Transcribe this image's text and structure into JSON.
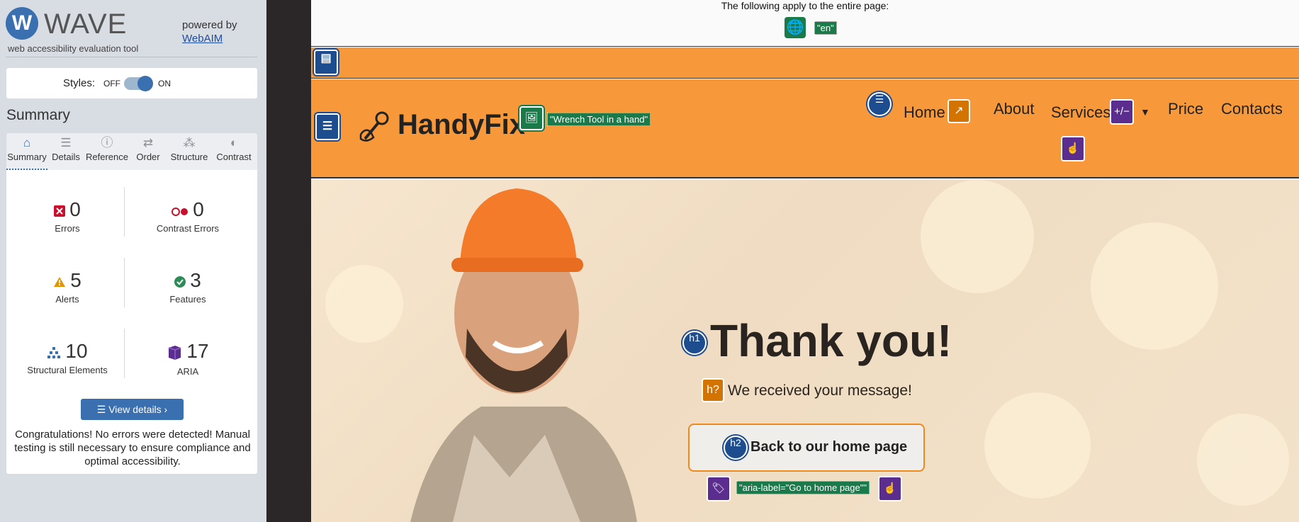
{
  "wave": {
    "logo_letter": "W",
    "brand": "WAVE",
    "tagline": "web accessibility evaluation tool",
    "powered_by": "powered by",
    "webaim_link": "WebAIM",
    "styles_label": "Styles:",
    "off": "OFF",
    "on": "ON",
    "summary_heading": "Summary",
    "tabs": [
      {
        "label": "Summary",
        "icon": "home-icon",
        "glyph": "⌂"
      },
      {
        "label": "Details",
        "icon": "list-icon",
        "glyph": "☰"
      },
      {
        "label": "Reference",
        "icon": "info-icon",
        "glyph": "ⓘ"
      },
      {
        "label": "Order",
        "icon": "order-icon",
        "glyph": "⇄"
      },
      {
        "label": "Structure",
        "icon": "structure-icon",
        "glyph": "⁂"
      },
      {
        "label": "Contrast",
        "icon": "contrast-icon",
        "glyph": "◐"
      }
    ],
    "stats": {
      "errors": {
        "count": "0",
        "label": "Errors"
      },
      "contrast_errors": {
        "count": "0",
        "label": "Contrast Errors"
      },
      "alerts": {
        "count": "5",
        "label": "Alerts"
      },
      "features": {
        "count": "3",
        "label": "Features"
      },
      "structural": {
        "count": "10",
        "label": "Structural Elements"
      },
      "aria": {
        "count": "17",
        "label": "ARIA"
      }
    },
    "view_details": "View details ›",
    "congrats": "Congratulations! No errors were detected! Manual testing is still necessary to ensure compliance and optimal accessibility."
  },
  "page": {
    "entire_note": "The following apply to the entire page:",
    "lang_tag": "\"en\"",
    "brand": "HandyFix",
    "logo_alt_tag": "\"Wrench Tool in a hand\"",
    "nav": [
      "Home",
      "About",
      "Services",
      "Price",
      "Contacts"
    ],
    "aria_plusminus": "+/−",
    "h1_badge": "h1",
    "h2_badge": "h2",
    "hq_badge": "h?",
    "heading": "Thank you!",
    "subheading": "We received your message!",
    "back_button": "Back to our home page",
    "aria_label_tag": "\"aria-label=\"Go to home page\"\""
  },
  "colors": {
    "wave_blue": "#3a6fb0",
    "header_orange": "#f7993a",
    "feature_green": "#1a7a49",
    "aria_purple": "#5b2d8e",
    "alert_orange": "#d47400"
  }
}
